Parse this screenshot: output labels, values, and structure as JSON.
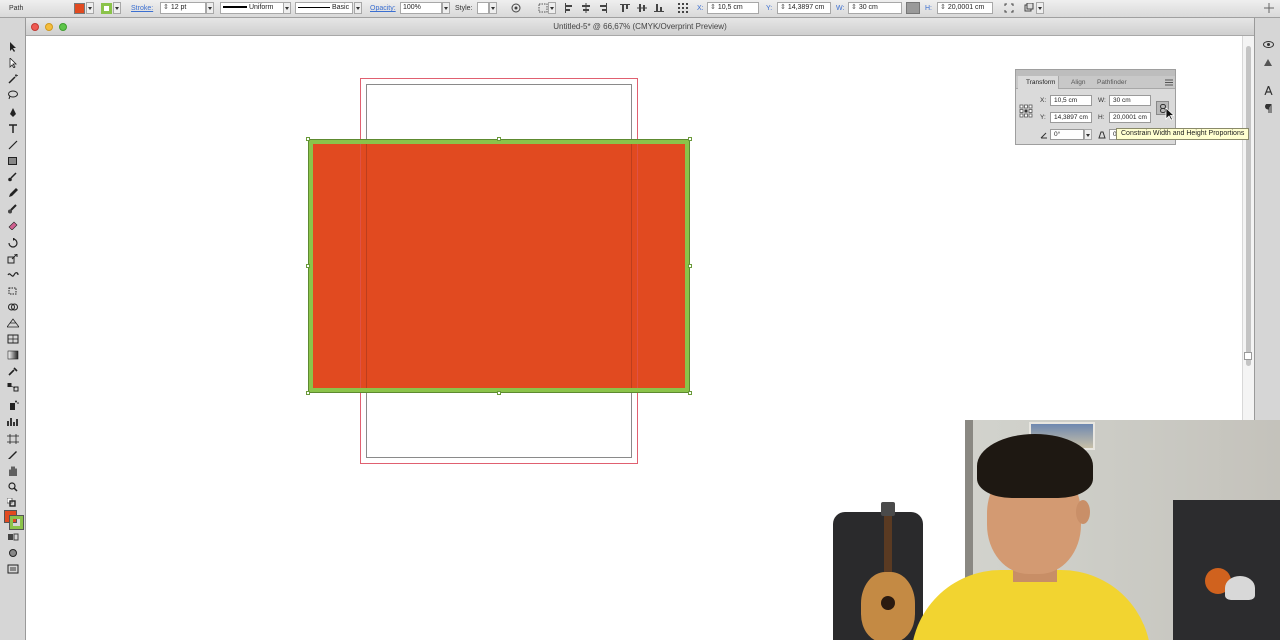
{
  "control_bar": {
    "object_type": "Path",
    "fill_color": "#e14a20",
    "stroke_color": "#8bc34a",
    "stroke_label": "Stroke:",
    "stroke_weight": "12 pt",
    "profile": "Uniform",
    "brush": "Basic",
    "opacity_label": "Opacity:",
    "opacity_value": "100%",
    "style_label": "Style:",
    "x_label": "X:",
    "x_value": "10,5 cm",
    "y_label": "Y:",
    "y_value": "14,3897 cm",
    "w_label": "W:",
    "w_value": "30 cm",
    "h_label": "H:",
    "h_value": "20,0001 cm"
  },
  "document": {
    "title": "Untitled-5* @ 66,67% (CMYK/Overprint Preview)"
  },
  "transform_panel": {
    "tabs": [
      "Transform",
      "Align",
      "Pathfinder"
    ],
    "x_label": "X:",
    "x_value": "10,5 cm",
    "y_label": "Y:",
    "y_value": "14,3897 cm",
    "w_label": "W:",
    "w_value": "30 cm",
    "h_label": "H:",
    "h_value": "20,0001 cm",
    "rotate_value": "0°",
    "shear_value": "0",
    "tooltip": "Constrain Width and Height Proportions"
  },
  "artwork": {
    "rect_fill": "#e14a20",
    "rect_stroke": "#8bc34a",
    "artboard_bleed": "#e06070"
  }
}
